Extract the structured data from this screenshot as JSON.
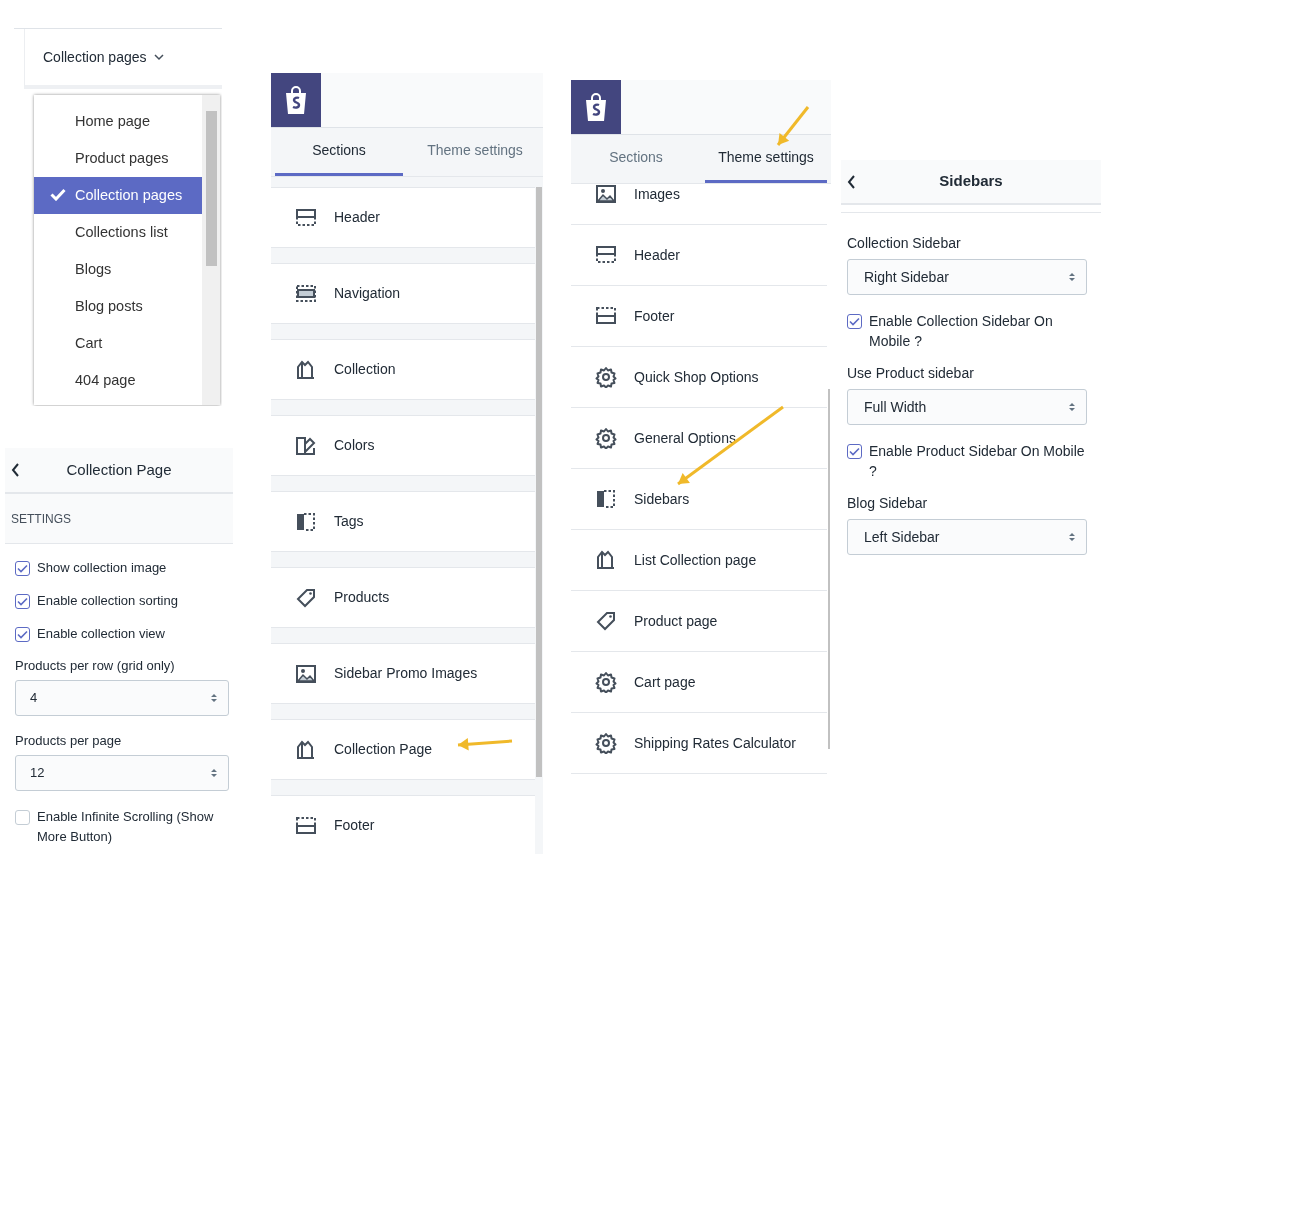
{
  "page_menu": {
    "current": "Collection pages",
    "items": [
      {
        "label": "Home page",
        "selected": false
      },
      {
        "label": "Product pages",
        "selected": false
      },
      {
        "label": "Collection pages",
        "selected": true
      },
      {
        "label": "Collections list",
        "selected": false
      },
      {
        "label": "Blogs",
        "selected": false
      },
      {
        "label": "Blog posts",
        "selected": false
      },
      {
        "label": "Cart",
        "selected": false
      },
      {
        "label": "404 page",
        "selected": false
      }
    ]
  },
  "collection_settings": {
    "title": "Collection Page",
    "section": "SETTINGS",
    "fields": [
      {
        "kind": "checkbox",
        "label": "Show collection image",
        "checked": true
      },
      {
        "kind": "checkbox",
        "label": "Enable collection sorting",
        "checked": true
      },
      {
        "kind": "checkbox",
        "label": "Enable collection view",
        "checked": true
      },
      {
        "kind": "select",
        "label": "Products per row (grid only)",
        "value": "4"
      },
      {
        "kind": "select",
        "label": "Products per page",
        "value": "12"
      },
      {
        "kind": "checkbox",
        "label": "Enable Infinite Scrolling (Show More Button)",
        "checked": false
      }
    ]
  },
  "sections_panel": {
    "tabs": [
      {
        "label": "Sections",
        "selected": true
      },
      {
        "label": "Theme settings",
        "selected": false
      }
    ],
    "items": [
      {
        "kind": "header",
        "label": "Header"
      },
      {
        "kind": "navigation",
        "label": "Navigation"
      },
      {
        "kind": "collection",
        "label": "Collection"
      },
      {
        "kind": "colors",
        "label": "Colors"
      },
      {
        "kind": "sidebar",
        "label": "Tags"
      },
      {
        "kind": "tag",
        "label": "Products"
      },
      {
        "kind": "image",
        "label": "Sidebar Promo Images"
      },
      {
        "kind": "collection",
        "label": "Collection Page"
      },
      {
        "kind": "footer",
        "label": "Footer"
      }
    ]
  },
  "theme_panel": {
    "tabs": [
      {
        "label": "Sections",
        "selected": false
      },
      {
        "label": "Theme settings",
        "selected": true
      }
    ],
    "items": [
      {
        "kind": "image",
        "label": "Images"
      },
      {
        "kind": "header",
        "label": "Header"
      },
      {
        "kind": "footer",
        "label": "Footer"
      },
      {
        "kind": "gear",
        "label": "Quick Shop Options"
      },
      {
        "kind": "gear",
        "label": "General Options"
      },
      {
        "kind": "sidebar",
        "label": "Sidebars"
      },
      {
        "kind": "collection",
        "label": "List Collection page"
      },
      {
        "kind": "tag",
        "label": "Product page"
      },
      {
        "kind": "gear",
        "label": "Cart page"
      },
      {
        "kind": "gear",
        "label": "Shipping Rates Calculator"
      }
    ]
  },
  "sidebars_panel": {
    "title": "Sidebars",
    "fields": [
      {
        "kind": "select",
        "label": "Collection Sidebar",
        "value": "Right Sidebar"
      },
      {
        "kind": "checkbox",
        "label": "Enable Collection Sidebar On Mobile ?",
        "checked": true
      },
      {
        "kind": "select",
        "label": "Use Product sidebar",
        "value": "Full Width"
      },
      {
        "kind": "checkbox",
        "label": "Enable Product Sidebar On Mobile ?",
        "checked": true
      },
      {
        "kind": "select",
        "label": "Blog Sidebar",
        "value": "Left Sidebar"
      }
    ]
  }
}
